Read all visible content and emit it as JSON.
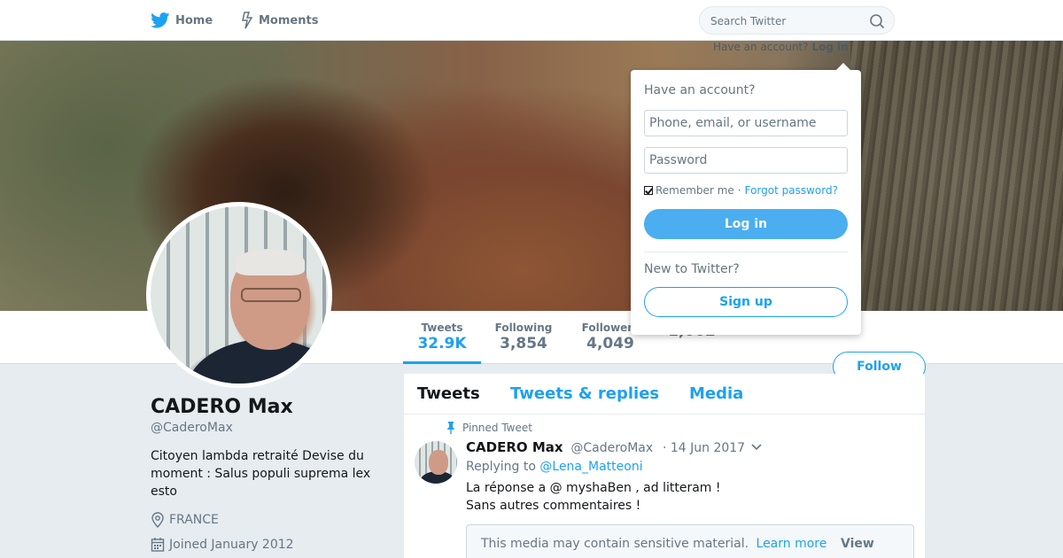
{
  "colors": {
    "accent": "#1da1f2",
    "text_muted": "#657786"
  },
  "nav": {
    "home_label": "Home",
    "moments_label": "Moments",
    "search_placeholder": "Search Twitter",
    "login_hint_text": "Have an account?",
    "login_hint_link": "Log in"
  },
  "profile": {
    "name": "CADERO Max",
    "handle": "@CaderoMax",
    "bio": "Citoyen lambda retraité Devise du moment : Salus populi suprema lex esto",
    "location": "FRANCE",
    "joined": "Joined January 2012",
    "follow_label": "Follow"
  },
  "stats": {
    "tweets": {
      "label": "Tweets",
      "value": "32.9K"
    },
    "following": {
      "label": "Following",
      "value": "3,854"
    },
    "followers": {
      "label": "Followers",
      "value": "4,049"
    },
    "likes": {
      "label": "",
      "value": "1,602"
    }
  },
  "timeline": {
    "tabs": [
      "Tweets",
      "Tweets & replies",
      "Media"
    ],
    "pinned_label": "Pinned Tweet",
    "tweet": {
      "name": "CADERO Max",
      "handle": "@CaderoMax",
      "date": "· 14 Jun 2017",
      "replying_to": "Replying to",
      "mention": "@Lena_Matteoni",
      "line1": "La réponse a @ myshaBen , ad litteram !",
      "line2": "Sans autres commentaires !",
      "sensitive_text": "This media may contain sensitive material.",
      "learn_more": "Learn more",
      "view_label": "View"
    }
  },
  "login_dropdown": {
    "title": "Have an account?",
    "username_placeholder": "Phone, email, or username",
    "password_placeholder": "Password",
    "remember_label": "Remember me",
    "separator": "·",
    "forgot_label": "Forgot password?",
    "login_button": "Log in",
    "new_label": "New to Twitter?",
    "signup_button": "Sign up"
  }
}
